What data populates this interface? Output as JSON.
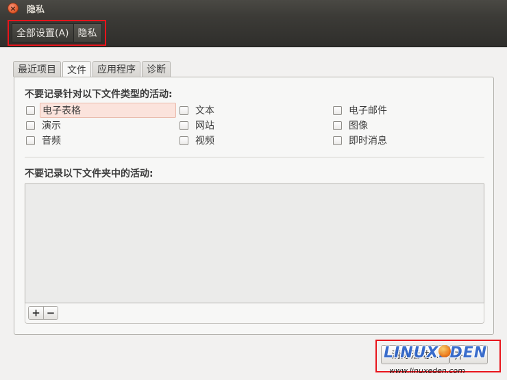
{
  "window": {
    "title": "隐私",
    "close_glyph": "×"
  },
  "toolbar": {
    "all_settings_label": "全部设置(A)",
    "current_label": "隐私"
  },
  "tabs": [
    {
      "label": "最近项目"
    },
    {
      "label": "文件"
    },
    {
      "label": "应用程序"
    },
    {
      "label": "诊断"
    }
  ],
  "active_tab": "文件",
  "files": {
    "types_heading": "不要记录针对以下文件类型的活动:",
    "file_types": [
      {
        "label": "电子表格",
        "checked": false
      },
      {
        "label": "文本",
        "checked": false
      },
      {
        "label": "电子邮件",
        "checked": false
      },
      {
        "label": "演示",
        "checked": false
      },
      {
        "label": "网站",
        "checked": false
      },
      {
        "label": "图像",
        "checked": false
      },
      {
        "label": "音频",
        "checked": false
      },
      {
        "label": "视频",
        "checked": false
      },
      {
        "label": "即时消息",
        "checked": false
      }
    ],
    "folders_heading": "不要记录以下文件夹中的活动:",
    "folders": [],
    "add_glyph": "+",
    "remove_glyph": "−"
  },
  "footer": {
    "clear_button_label": "清除活动...",
    "toggle_label": "开"
  },
  "watermark": {
    "logo_text": "LINUXEDEN",
    "url": "www.linuxeden.com"
  },
  "colors": {
    "highlight_border": "#e8141b",
    "titlebar": "#3c3b37",
    "focus_fill": "#fbe3dc"
  },
  "icons": {
    "close": "close-icon",
    "add": "plus-icon",
    "remove": "minus-icon"
  }
}
